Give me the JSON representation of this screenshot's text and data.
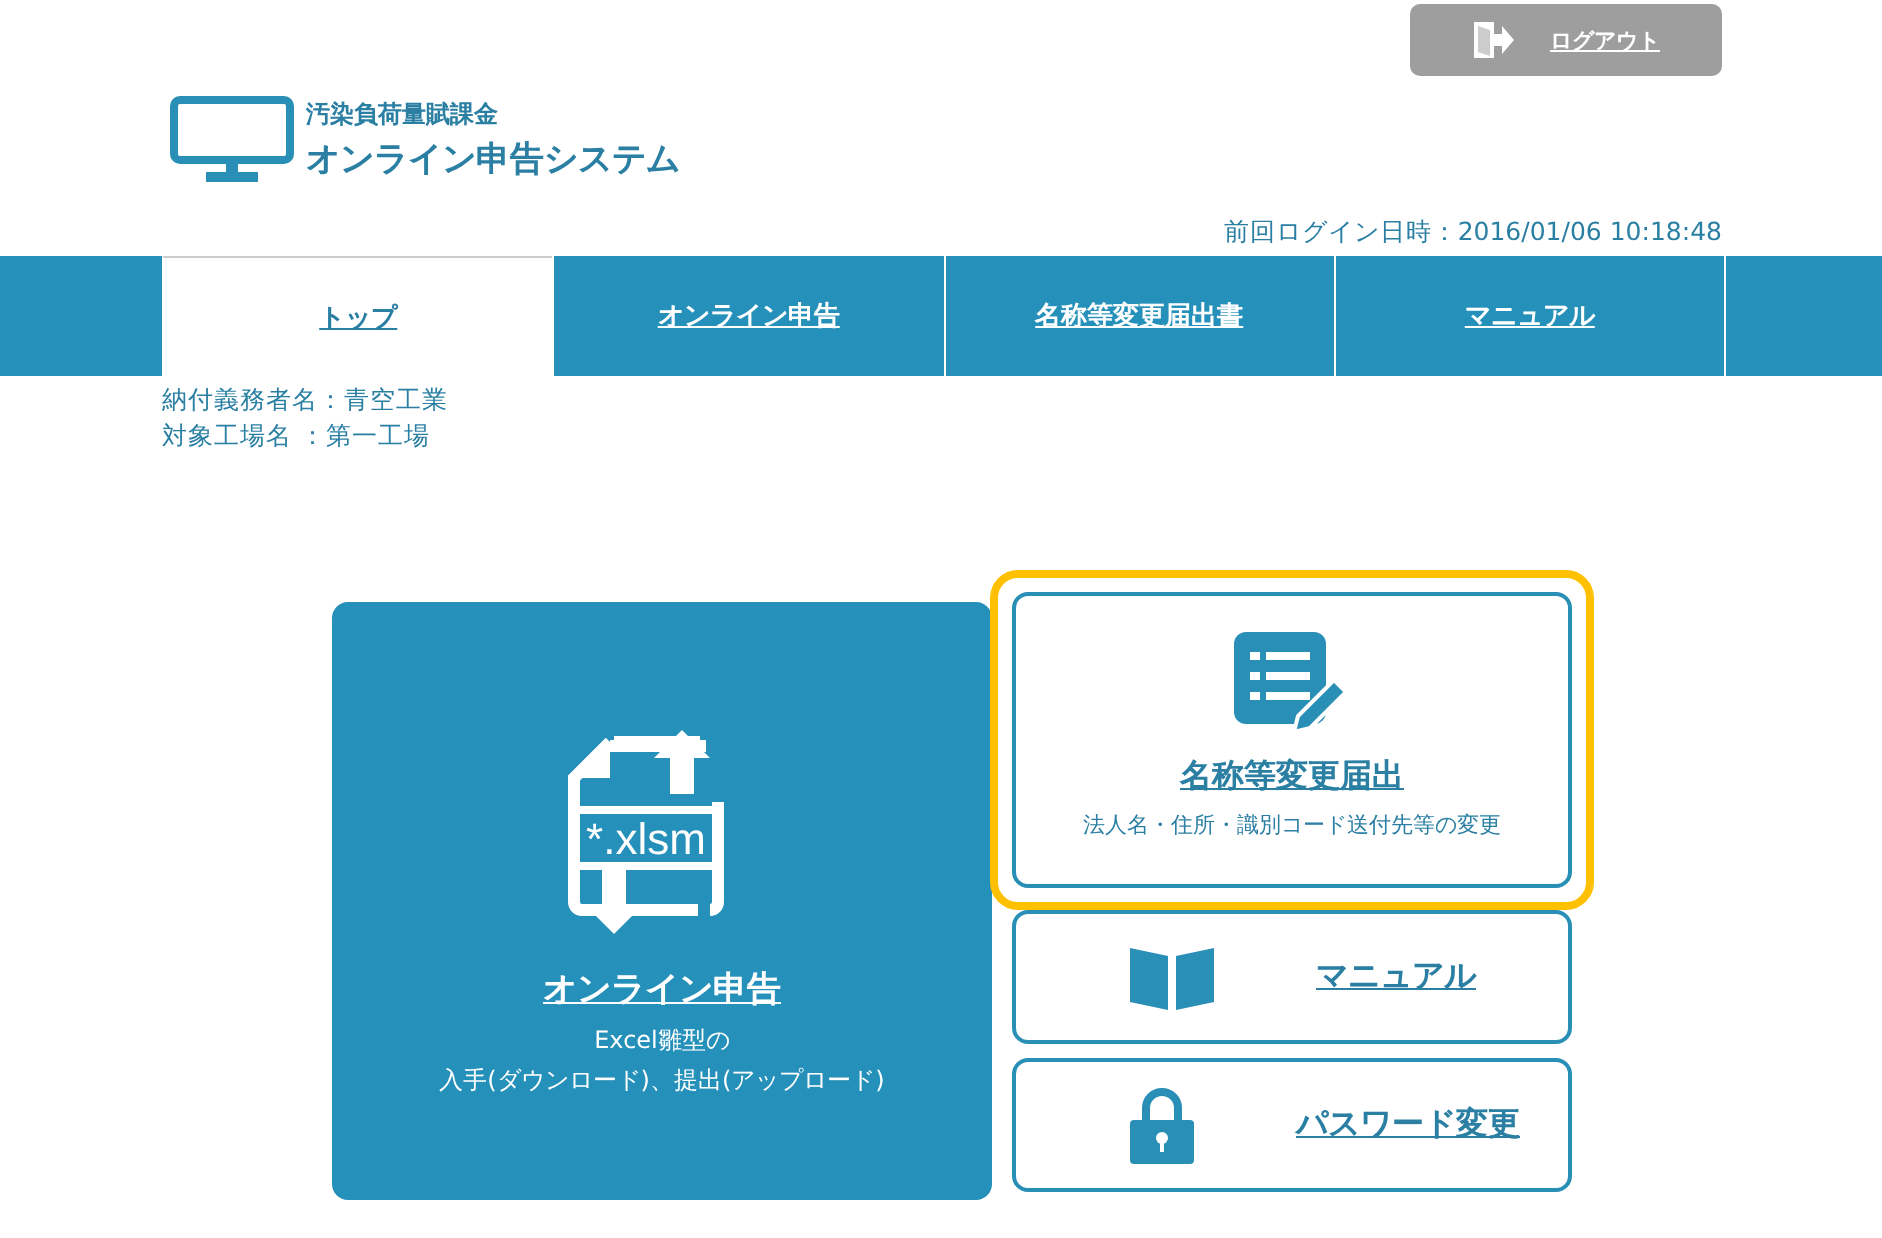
{
  "logout_button": {
    "label": "ログアウト"
  },
  "logo": {
    "subtitle": "汚染負荷量賦課金",
    "title": "オンライン申告システム"
  },
  "last_login": "前回ログイン日時：2016/01/06 10:18:48",
  "tabs": [
    {
      "label": "トップ",
      "selected": true
    },
    {
      "label": "オンライン申告",
      "selected": false
    },
    {
      "label": "名称等変更届出書",
      "selected": false
    },
    {
      "label": "マニュアル",
      "selected": false
    }
  ],
  "info": [
    "納付義務者名：青空工業",
    "対象工場名 ：第一工場"
  ],
  "main_tile": {
    "icon_text": "*.xlsm",
    "title": "オンライン申告",
    "description": [
      "Excel雛型の",
      "入手(ダウンロード)、提出(アップロード)"
    ]
  },
  "cards": [
    {
      "kind": "form",
      "title": "名称等変更届出",
      "description": "法人名・住所・識別コード送付先等の変更",
      "selected": true
    },
    {
      "kind": "manual",
      "title": "マニュアル",
      "selected": false
    },
    {
      "kind": "password",
      "title": "パスワード変更",
      "selected": false
    }
  ]
}
